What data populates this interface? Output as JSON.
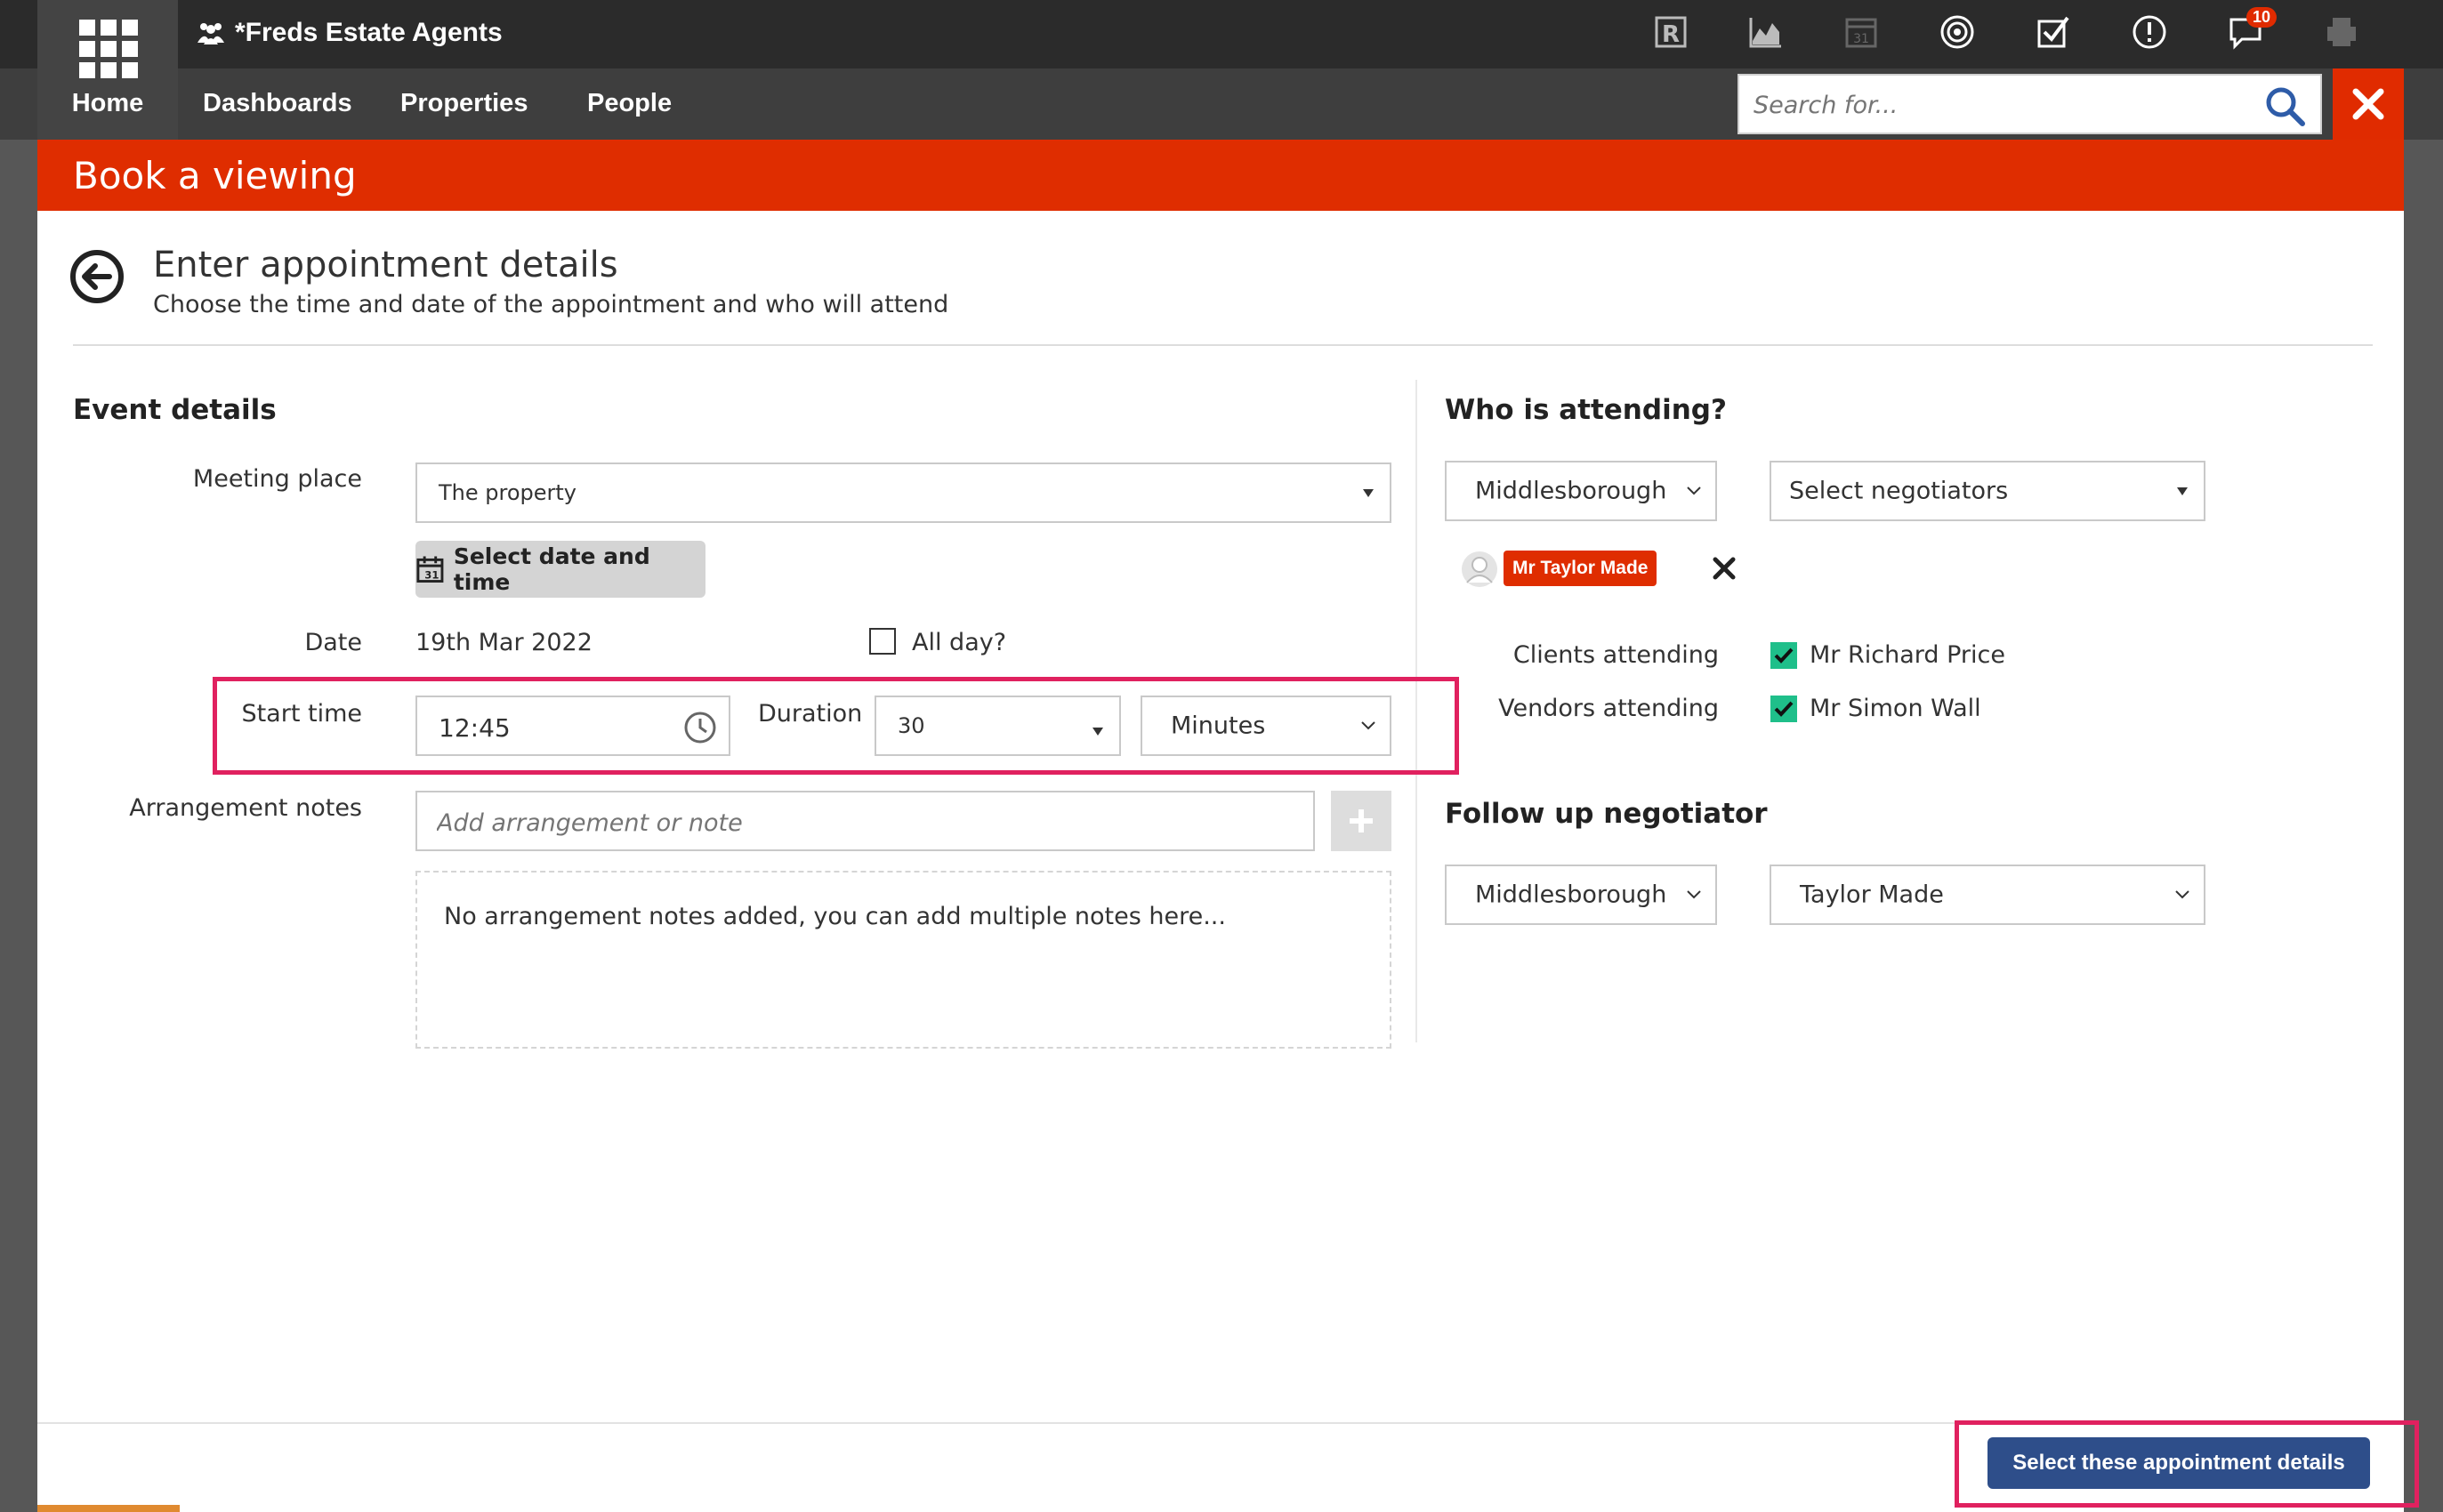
{
  "topbar": {
    "home_label": "Home",
    "agency_name": "*Freds Estate Agents",
    "notifications_count": "10",
    "icons": [
      "rightmove-r-icon",
      "chart-icon",
      "calendar-icon",
      "target-icon",
      "tasks-check-icon",
      "alert-icon",
      "chat-icon",
      "print-icon"
    ]
  },
  "nav": {
    "items": [
      "Dashboards",
      "Properties",
      "People"
    ]
  },
  "search": {
    "placeholder": "Search for..."
  },
  "banner": {
    "title": "Book a viewing"
  },
  "header": {
    "title": "Enter appointment details",
    "subtitle": "Choose the time and date of the appointment and who will attend"
  },
  "event": {
    "section_title": "Event details",
    "meeting_place_label": "Meeting place",
    "meeting_place_value": "The property",
    "select_date_button": "Select date and time",
    "date_label": "Date",
    "date_value": "19th Mar 2022",
    "all_day_label": "All day?",
    "start_time_label": "Start time",
    "start_time_value": "12:45",
    "duration_label": "Duration",
    "duration_value": "30",
    "duration_unit": "Minutes",
    "notes_label": "Arrangement notes",
    "notes_placeholder": "Add arrangement or note",
    "notes_empty": "No arrangement notes added, you can add multiple notes here..."
  },
  "attending": {
    "section_title": "Who is attending?",
    "branch_value": "Middlesborough",
    "negotiators_placeholder": "Select negotiators",
    "selected_negotiator": "Mr Taylor Made",
    "clients_label": "Clients attending",
    "client_name": "Mr Richard Price",
    "vendors_label": "Vendors attending",
    "vendor_name": "Mr Simon Wall"
  },
  "followup": {
    "section_title": "Follow up negotiator",
    "branch_value": "Middlesborough",
    "negotiator_value": "Taylor Made"
  },
  "footer": {
    "primary_button": "Select these appointment details"
  },
  "colors": {
    "accent_red": "#df2d00",
    "highlight_pink": "#e0215f",
    "primary_blue": "#2e4e8a",
    "check_green": "#1fbf8a"
  }
}
